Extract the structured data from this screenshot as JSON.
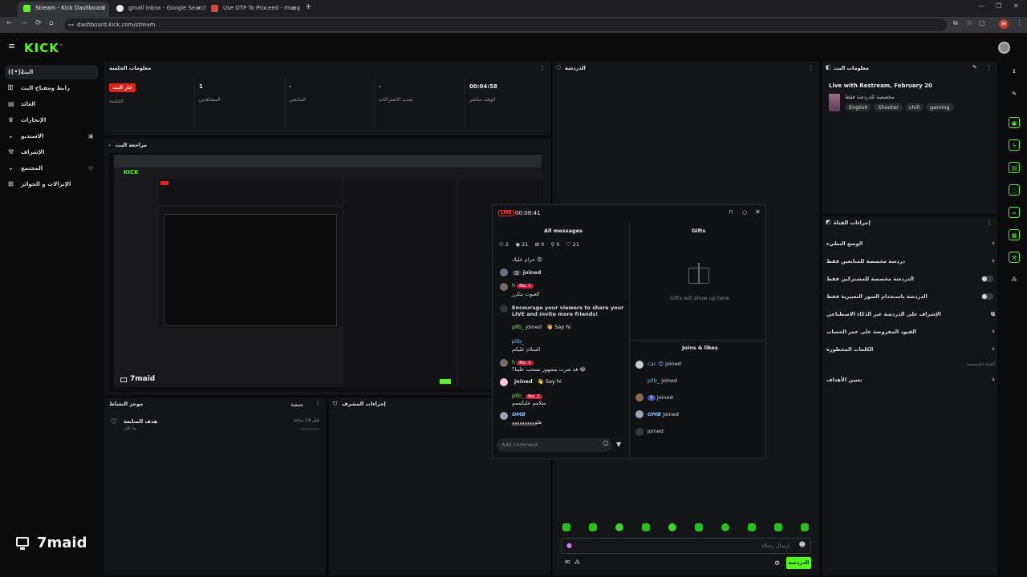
{
  "browser": {
    "tabs": [
      {
        "title": "Stream - Kick Dashboard",
        "active": true,
        "favicon_color": "#53fc18"
      },
      {
        "title": "gmail inbox - Google Search",
        "active": false,
        "favicon_color": "#e9e9e9"
      },
      {
        "title": "Use OTP To Proceed - moagS...",
        "active": false,
        "favicon_color": "#d34836"
      }
    ],
    "new_tab": "+",
    "url": "dashboard.kick.com/stream",
    "profile_initial": "M"
  },
  "app": {
    "logo": "KICK",
    "logo_mark": "™"
  },
  "sidebar": {
    "items": [
      {
        "label": "البث",
        "icon": "broadcast-icon",
        "active": true
      },
      {
        "label": "رابط ومفتاح البث",
        "icon": "key-icon"
      },
      {
        "label": "العائد",
        "icon": "money-icon"
      },
      {
        "label": "الإنجازات",
        "icon": "trophy-icon"
      },
      {
        "label": "الاستديو",
        "icon": "chevron-down-icon"
      },
      {
        "label": "الإشراف",
        "icon": "moderation-icon"
      },
      {
        "label": "المجتمع",
        "icon": "chevron-down-icon"
      },
      {
        "label": "الإنزالات و الجوائز",
        "icon": "gift-icon"
      }
    ],
    "footer_name": "7maid"
  },
  "session": {
    "title": "معلومات الجلسة",
    "live_badge": "جار البث",
    "live_label": "الجلسة",
    "stats": [
      {
        "value": "1",
        "label": "المشاهدين"
      },
      {
        "value": "-",
        "label": "المتابعين"
      },
      {
        "value": "-",
        "label": "تجديد الاشتراكات"
      },
      {
        "value": "00:04:58",
        "label": "الوقت مباشر"
      }
    ]
  },
  "preview": {
    "title": "مراجعة البث",
    "watermark": "7maid"
  },
  "bottom_panels": {
    "activity": {
      "title": "موجز النشاط",
      "filter": "تصفية",
      "goal_title": "هدف المتابعة",
      "goal_sub": "بدأ الآن",
      "time_ago": "قبل 14 ساعة"
    },
    "mod_actions": {
      "title": "إجراءات المشرف"
    }
  },
  "chat": {
    "title": "الدردشة",
    "input_placeholder": "إرسال رسالة",
    "send_label": "الدردشة",
    "infinity": "∞"
  },
  "stream_info": {
    "title": "معلومات البث",
    "stream_title": "Live with Restream, February 20",
    "category": "مخصصة للدردشة فقط",
    "tags": [
      "English",
      "Shooter",
      "chill",
      "gaming"
    ]
  },
  "channel_actions": {
    "title": "إجراءات القناة",
    "rows": [
      {
        "label": "الوضع البطيء",
        "control": "chevron"
      },
      {
        "label": "دردشة مخصصة للمتابعين فقط",
        "control": "chevron"
      },
      {
        "label": "الدردشة مخصصة للمشتركين فقط",
        "control": "toggle"
      },
      {
        "label": "الدردشة باستخدام الصور التعبيرية فقط",
        "control": "toggle"
      },
      {
        "label": "الإشراف على الدردشة عبر الذكاء الاصطناعي",
        "control": "external"
      },
      {
        "label": "القيود المفروضة على عمر الحساب",
        "control": "chevron"
      },
      {
        "label": "الكلمات المحظورة",
        "control": "chevron"
      },
      {
        "label": "القناة الشخصية",
        "control": "none"
      },
      {
        "label": "تعيين الأهداف",
        "control": "chevron"
      }
    ]
  },
  "popup": {
    "live": "LIVE",
    "timer": "00:08:41",
    "messages_title": "All messages",
    "gifts_title": "Gifts",
    "gifts_empty": "Gifts will show up here",
    "joins_title": "Joins & likes",
    "stats": [
      "2",
      "21",
      "0",
      "0",
      "21"
    ],
    "add_comment": "Add comment",
    "messages": [
      {
        "user": "",
        "text": "حرام عليك 😡"
      },
      {
        "user": "",
        "text": "joined"
      },
      {
        "user": "h",
        "badge": "No. 1",
        "text": "العبوت بتكرر"
      },
      {
        "user": "",
        "text": "Encourage your viewers to share your LIVE and invite more friends!"
      },
      {
        "user": "pllb_",
        "text": "joined",
        "action": "Say hi"
      },
      {
        "user": "pllb_",
        "text": "السلام عليكم"
      },
      {
        "user": "h",
        "badge": "No. 1",
        "text": "قد صرت مشهور تسحب علينا؟ 😂"
      },
      {
        "user": "",
        "text": "joined",
        "action": "Say hi"
      },
      {
        "user": "pllb_",
        "badge": "No. 2",
        "text": "سلامم عليكممم"
      },
      {
        "user": "OMB",
        "text": "هلوووووووووو"
      }
    ],
    "joins": [
      {
        "user": "cac 😊",
        "text": "joined"
      },
      {
        "user": "pllb_",
        "text": "joined"
      },
      {
        "user": "",
        "text": "joined",
        "pill": "9"
      },
      {
        "user": "OMB",
        "text": "joined"
      },
      {
        "user": "",
        "text": "joined"
      }
    ]
  },
  "colors": {
    "accent": "#53fc18",
    "live_red": "#e2231a",
    "panel": "#141516",
    "background": "#0b0b0c"
  }
}
